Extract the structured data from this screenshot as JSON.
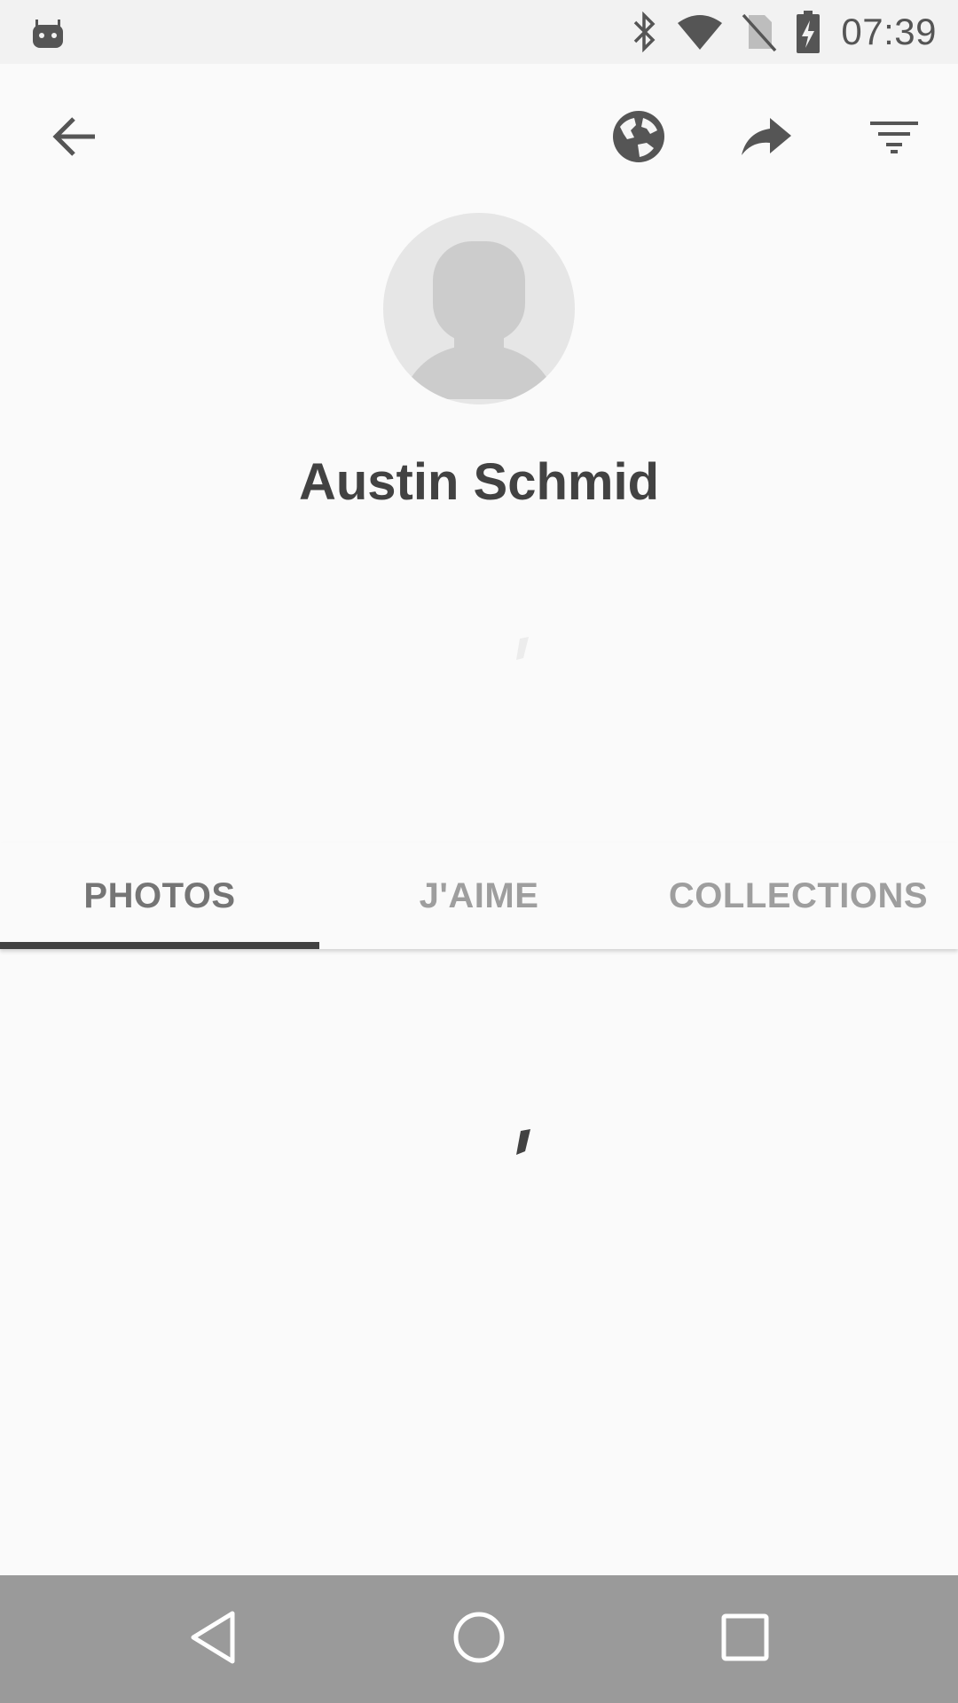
{
  "status_bar": {
    "time": "07:39",
    "icons": [
      "android-debug-icon",
      "bluetooth-icon",
      "wifi-icon",
      "no-sim-icon",
      "battery-charging-icon"
    ]
  },
  "toolbar": {
    "icons": [
      "back-arrow-icon",
      "globe-icon",
      "share-icon",
      "filter-icon"
    ]
  },
  "profile": {
    "name": "Austin Schmid"
  },
  "tabs": [
    {
      "label": "PHOTOS",
      "active": true
    },
    {
      "label": "J'AIME",
      "active": false
    },
    {
      "label": "COLLECTIONS",
      "active": false
    }
  ],
  "nav_bar": {
    "icons": [
      "nav-back-icon",
      "nav-home-icon",
      "nav-recents-icon"
    ]
  },
  "colors": {
    "background": "#fafafa",
    "status_bar": "#f2f2f2",
    "nav_bar": "#9a9a9a",
    "text_primary": "#424242",
    "tab_inactive": "#9e9e9e",
    "indicator": "#424242"
  }
}
